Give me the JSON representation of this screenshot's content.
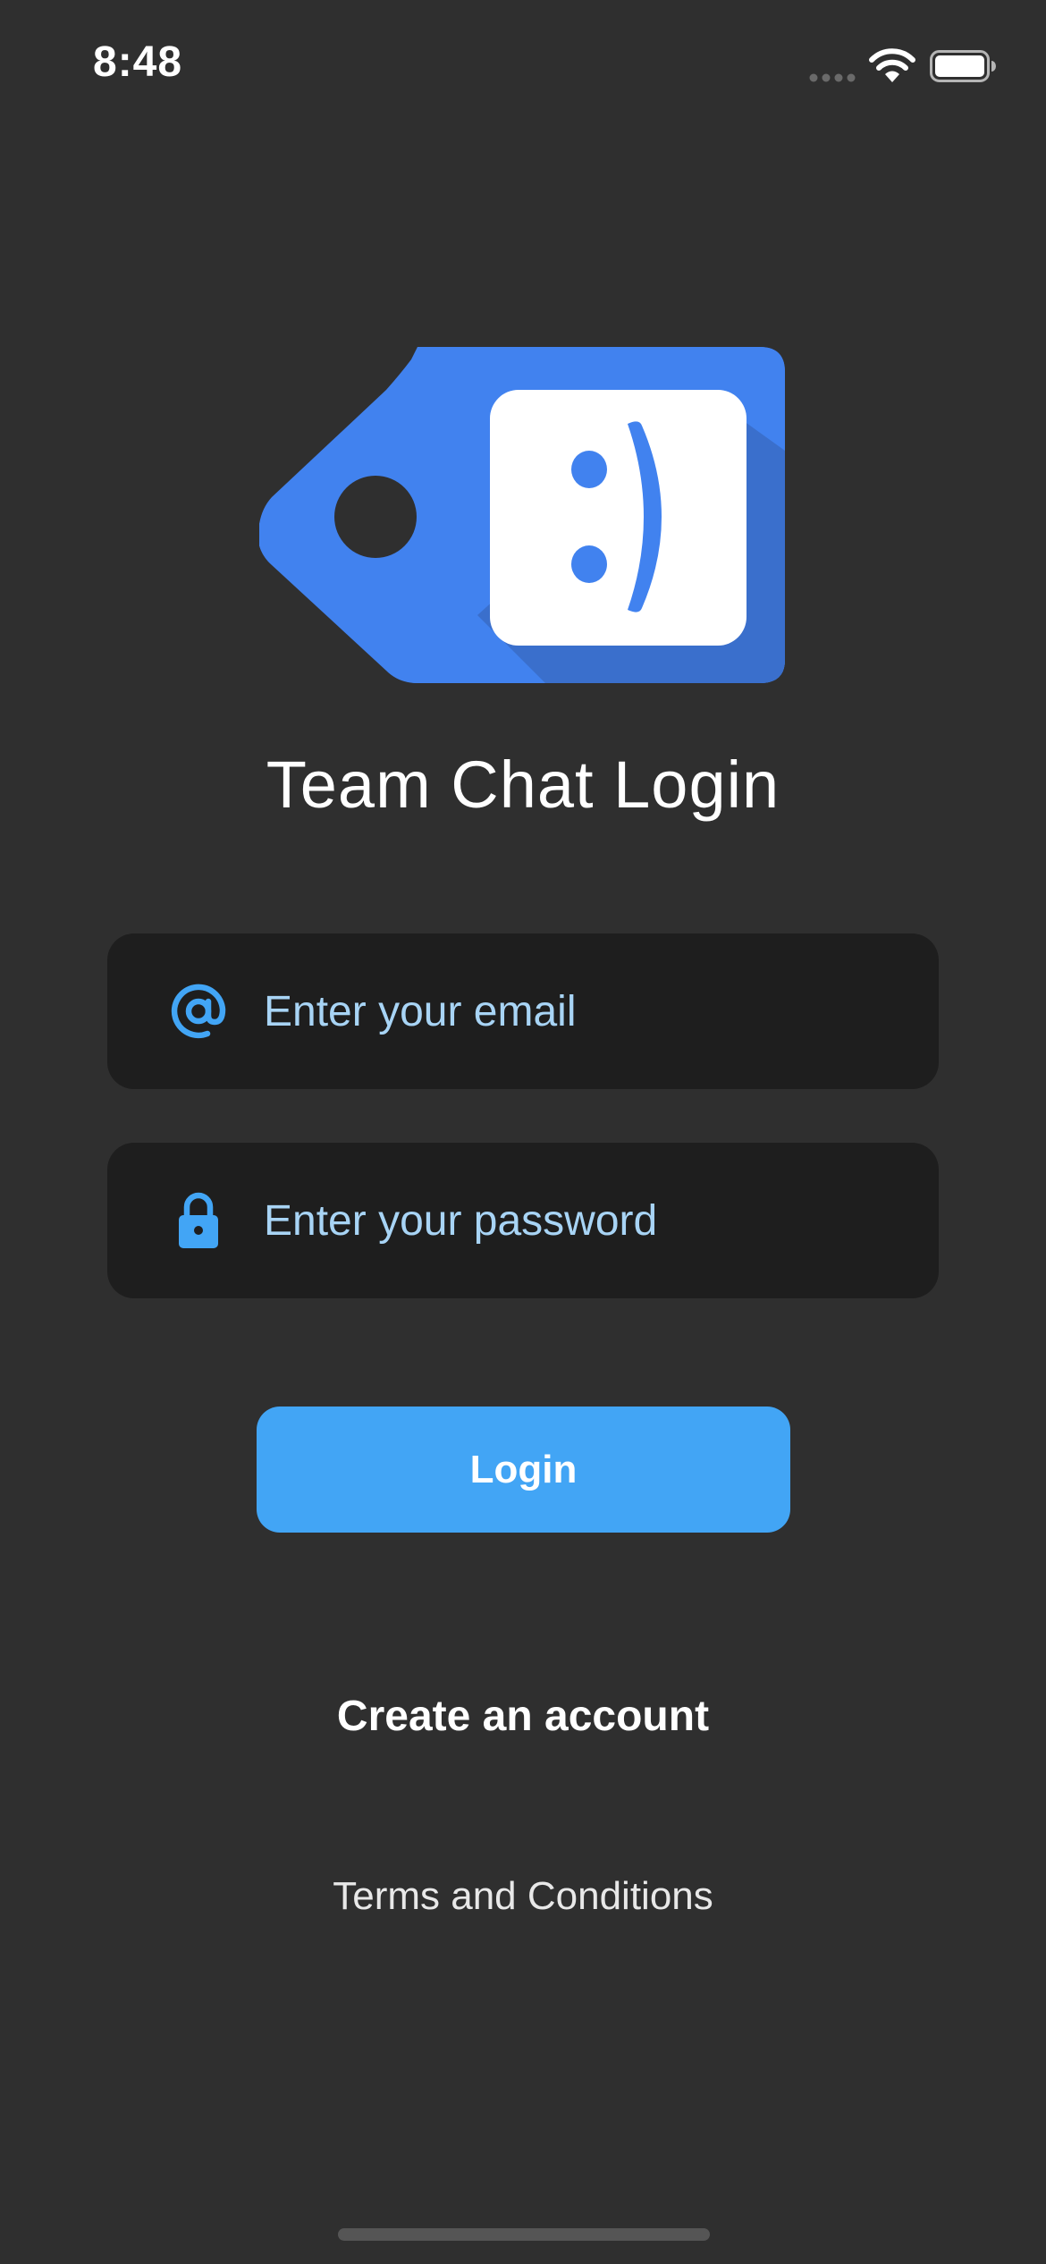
{
  "status_bar": {
    "time": "8:48"
  },
  "app": {
    "title": "Team Chat Login"
  },
  "login_form": {
    "email_placeholder": "Enter your email",
    "password_placeholder": "Enter your password",
    "login_label": "Login"
  },
  "links": {
    "create_account": "Create an account",
    "terms": "Terms and Conditions"
  },
  "colors": {
    "background": "#2f2f2f",
    "field_background": "#1e1e1e",
    "accent": "#42a5f5",
    "logo_blue": "#4182ef",
    "placeholder_text": "#a8d4f5"
  },
  "icons": {
    "email": "at-sign-icon",
    "password": "lock-icon",
    "logo": "smiley-tag-icon"
  }
}
